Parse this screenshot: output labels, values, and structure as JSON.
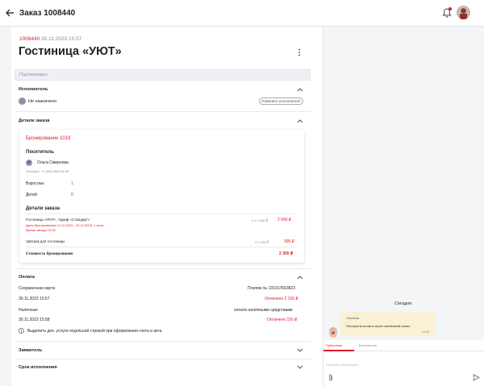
{
  "header": {
    "title": "Заказ 1008440"
  },
  "order": {
    "number": "1008440",
    "date": "30.11.2023 15:57",
    "hotel": "Гостиница «УЮТ»",
    "status": "Подтвержден"
  },
  "executor": {
    "heading": "Исполнитель",
    "name": "Не назначено",
    "change_label": "Изменить исполнителя"
  },
  "details": {
    "heading": "Детали заказа",
    "booking_title": "Бронирование 1019",
    "visitor_heading": "Посетитель",
    "visitor_name": "Ольга Смирнова",
    "visitor_phone": "Телефон: +7 (905) 889-03-59",
    "adults_label": "Взрослых",
    "adults_value": "1",
    "children_label": "Детей",
    "children_value": "0",
    "order_heading": "Детали заказа",
    "item1_name": "Гостиница «УЮТ», тариф «Стандарт»",
    "item1_dates": "Даты бронирования 14.12.2023 - 16.12.2023, 2 ночи",
    "item1_time": "Время заезда 10:00",
    "item1_qty": "2 x 1 000 ₽",
    "item1_total": "2 000 ₽",
    "item2_name": "Завтрак для гостиницы",
    "item2_qty": "2 x 150 ₽",
    "item2_total": "300 ₽",
    "total_label": "Стоимость бронирования",
    "total_value": "2 300 ₽"
  },
  "payment": {
    "heading": "Оплата",
    "saved_card_label": "Сохраненная карта",
    "saved_card_payment": "Платеж № 131017663823",
    "saved_card_date": "30.11.2023 15:57",
    "saved_card_status": "Оплачено 2 150 ₽",
    "cash_label": "Наличные",
    "cash_desc": "оплата наличными средствами",
    "cash_date": "30.11.2023 15:58",
    "cash_status": "Оплачено 150 ₽",
    "info_text": "Выделить доп. услуги отдельной строкой при оформлении счета и акта"
  },
  "applicant": {
    "heading": "Заявитель"
  },
  "deadline": {
    "heading": "Срок исполнения"
  },
  "chat": {
    "day_label": "Сегодня",
    "sender": "Система",
    "message": "Поступила оплата через платёжный шлюз.",
    "time": "15:58",
    "tab_public": "Публичная",
    "tab_internal": "Внутренняя",
    "input_placeholder": "Написать сообщение..."
  },
  "colors": {
    "accent": "#d81e2a",
    "message_bg": "#faf0d4",
    "status_bg": "#eef0f4"
  }
}
